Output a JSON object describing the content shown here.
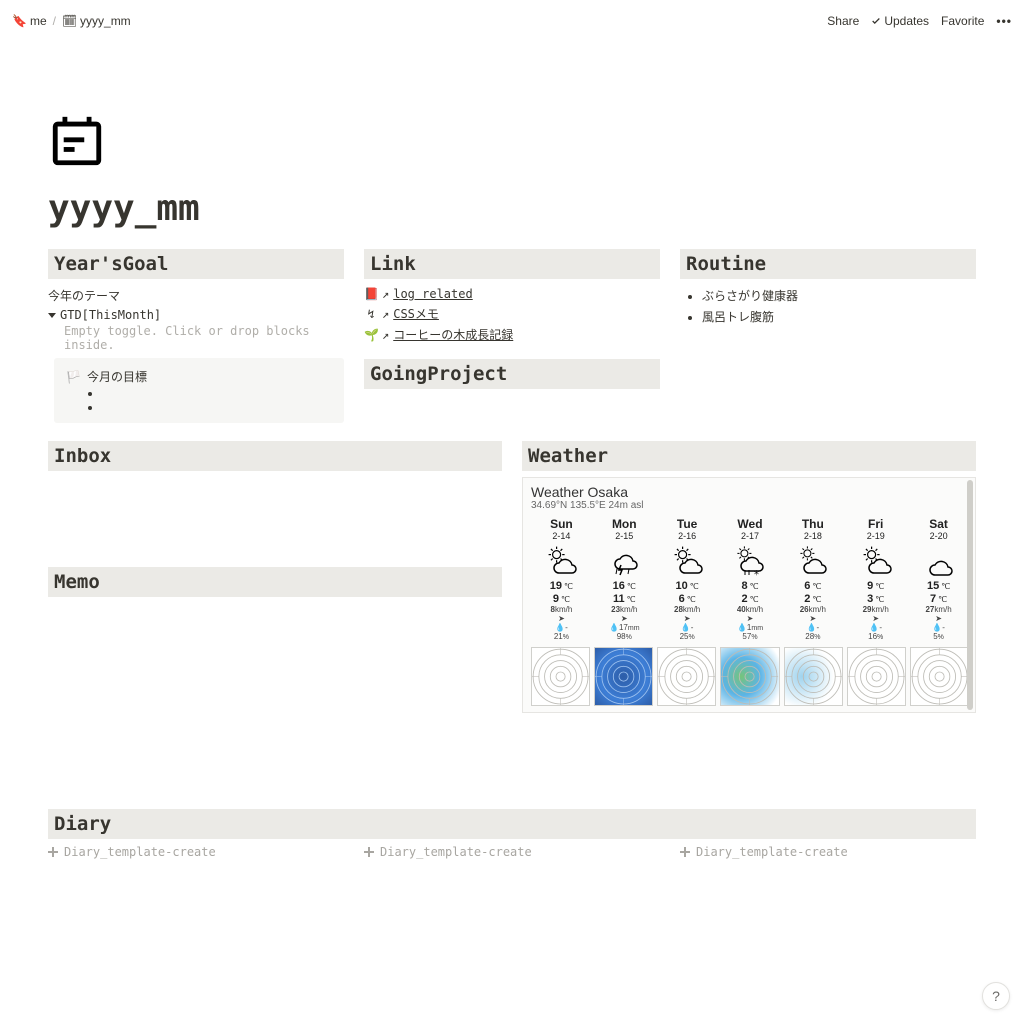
{
  "breadcrumb": {
    "root": "me",
    "page": "yyyy_mm"
  },
  "topbar": {
    "share": "Share",
    "updates": "Updates",
    "favorite": "Favorite"
  },
  "page": {
    "title": "yyyy_mm"
  },
  "yearsgoal": {
    "heading": "Year'sGoal",
    "theme_label": "今年のテーマ",
    "toggle_label": "GTD[ThisMonth]",
    "toggle_empty": "Empty toggle. Click or drop blocks inside.",
    "callout_title": "今月の目標"
  },
  "link": {
    "heading": "Link",
    "items": [
      {
        "icon": "📕",
        "label": "log related"
      },
      {
        "icon": "↯",
        "label": "CSSメモ"
      },
      {
        "icon": "🌱",
        "label": "コーヒーの木成長記録"
      }
    ]
  },
  "goingproject": {
    "heading": "GoingProject"
  },
  "routine": {
    "heading": "Routine",
    "items": [
      "ぶらさがり健康器",
      "風呂トレ腹筋"
    ]
  },
  "inbox": {
    "heading": "Inbox"
  },
  "memo": {
    "heading": "Memo"
  },
  "weather": {
    "heading": "Weather",
    "title": "Weather Osaka",
    "coords": "34.69°N 135.5°E 24m asl",
    "days": [
      {
        "name": "Sun",
        "date": "2-14",
        "hi": "19",
        "lo": "9",
        "wind": "8",
        "precip": "-",
        "humidity": "21",
        "icon": "sun-cloud"
      },
      {
        "name": "Mon",
        "date": "2-15",
        "hi": "16",
        "lo": "11",
        "wind": "23",
        "precip": "17",
        "humidity": "98",
        "icon": "storm"
      },
      {
        "name": "Tue",
        "date": "2-16",
        "hi": "10",
        "lo": "6",
        "wind": "28",
        "precip": "-",
        "humidity": "25",
        "icon": "sun-cloud"
      },
      {
        "name": "Wed",
        "date": "2-17",
        "hi": "8",
        "lo": "2",
        "wind": "40",
        "precip": "1",
        "humidity": "57",
        "icon": "snow"
      },
      {
        "name": "Thu",
        "date": "2-18",
        "hi": "6",
        "lo": "2",
        "wind": "26",
        "precip": "-",
        "humidity": "28",
        "icon": "cloud"
      },
      {
        "name": "Fri",
        "date": "2-19",
        "hi": "9",
        "lo": "3",
        "wind": "29",
        "precip": "-",
        "humidity": "16",
        "icon": "sun-cloud"
      },
      {
        "name": "Sat",
        "date": "2-20",
        "hi": "15",
        "lo": "7",
        "wind": "27",
        "precip": "-",
        "humidity": "5",
        "icon": "cloudy"
      }
    ],
    "unit_temp": "℃",
    "unit_wind": "km/h",
    "unit_precip": "mm",
    "unit_humidity": "%"
  },
  "diary": {
    "heading": "Diary",
    "create_label": "Diary_template-create"
  },
  "help": {
    "label": "?"
  }
}
